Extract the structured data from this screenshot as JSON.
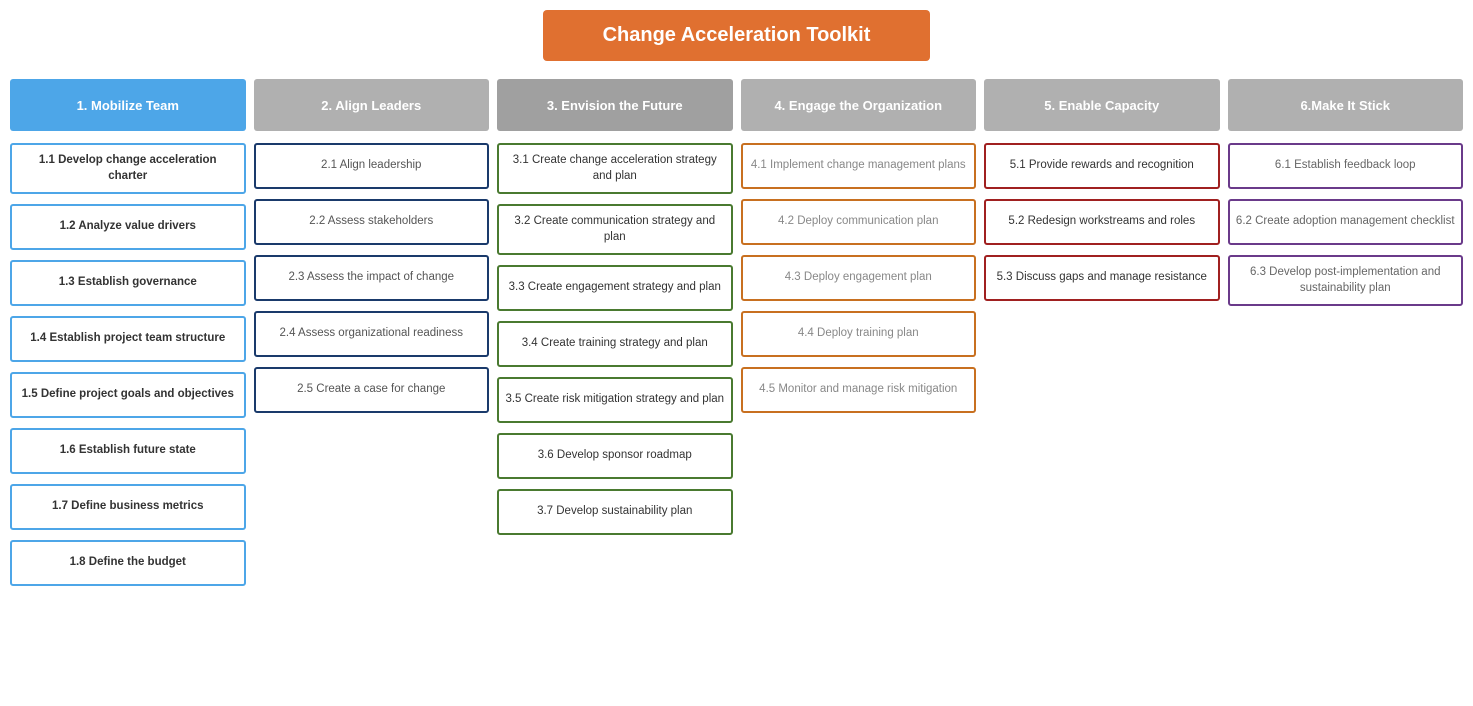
{
  "title": "Change Acceleration Toolkit",
  "columns": [
    {
      "id": "col1",
      "header": "1. Mobilize Team",
      "headerClass": "col1-header",
      "cards": [
        {
          "text": "1.1 Develop change acceleration charter",
          "style": "card-blue"
        },
        {
          "text": "1.2 Analyze value drivers",
          "style": "card-blue"
        },
        {
          "text": "1.3 Establish governance",
          "style": "card-blue"
        },
        {
          "text": "1.4 Establish project team structure",
          "style": "card-blue"
        },
        {
          "text": "1.5 Define project goals and objectives",
          "style": "card-blue"
        },
        {
          "text": "1.6 Establish future state",
          "style": "card-blue"
        },
        {
          "text": "1.7 Define business metrics",
          "style": "card-blue"
        },
        {
          "text": "1.8 Define the budget",
          "style": "card-blue"
        }
      ]
    },
    {
      "id": "col2",
      "header": "2. Align Leaders",
      "headerClass": "col2-header",
      "cards": [
        {
          "text": "2.1 Align leadership",
          "style": "card-dark-blue"
        },
        {
          "text": "2.2 Assess stakeholders",
          "style": "card-dark-blue"
        },
        {
          "text": "2.3 Assess the impact of change",
          "style": "card-dark-blue"
        },
        {
          "text": "2.4 Assess organizational readiness",
          "style": "card-dark-blue"
        },
        {
          "text": "2.5 Create a case for change",
          "style": "card-dark-blue"
        }
      ]
    },
    {
      "id": "col3",
      "header": "3. Envision the Future",
      "headerClass": "col3-header",
      "cards": [
        {
          "text": "3.1 Create change acceleration strategy and plan",
          "style": "card-green"
        },
        {
          "text": "3.2 Create communication strategy and plan",
          "style": "card-green"
        },
        {
          "text": "3.3 Create engagement strategy and plan",
          "style": "card-green"
        },
        {
          "text": "3.4 Create training strategy and plan",
          "style": "card-green"
        },
        {
          "text": "3.5 Create risk mitigation strategy and plan",
          "style": "card-green"
        },
        {
          "text": "3.6 Develop sponsor roadmap",
          "style": "card-green"
        },
        {
          "text": "3.7 Develop sustainability plan",
          "style": "card-green"
        }
      ]
    },
    {
      "id": "col4",
      "header": "4. Engage the Organization",
      "headerClass": "col4-header",
      "cards": [
        {
          "text": "4.1 Implement change management plans",
          "style": "card-orange"
        },
        {
          "text": "4.2 Deploy communication plan",
          "style": "card-orange"
        },
        {
          "text": "4.3 Deploy engagement plan",
          "style": "card-orange"
        },
        {
          "text": "4.4 Deploy training plan",
          "style": "card-orange"
        },
        {
          "text": "4.5 Monitor and manage risk mitigation",
          "style": "card-orange"
        }
      ]
    },
    {
      "id": "col5",
      "header": "5. Enable Capacity",
      "headerClass": "col5-header",
      "cards": [
        {
          "text": "5.1 Provide rewards and recognition",
          "style": "card-red"
        },
        {
          "text": "5.2 Redesign workstreams and roles",
          "style": "card-red"
        },
        {
          "text": "5.3 Discuss gaps and manage resistance",
          "style": "card-red"
        }
      ]
    },
    {
      "id": "col6",
      "header": "6.Make It Stick",
      "headerClass": "col6-header",
      "cards": [
        {
          "text": "6.1 Establish feedback loop",
          "style": "card-purple"
        },
        {
          "text": "6.2 Create adoption management checklist",
          "style": "card-purple"
        },
        {
          "text": "6.3 Develop post-implementation and sustainability plan",
          "style": "card-purple"
        }
      ]
    }
  ]
}
